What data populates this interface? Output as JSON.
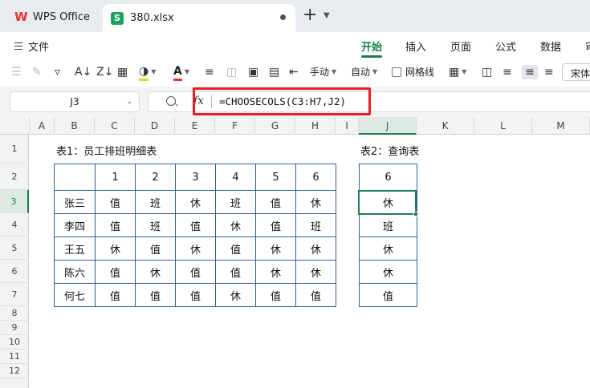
{
  "tabs": {
    "home_label": "WPS Office",
    "file_label": "380.xlsx",
    "new_tab": "+"
  },
  "menu": {
    "file": "文件",
    "ribbon": [
      "开始",
      "插入",
      "页面",
      "公式",
      "数据",
      "审"
    ]
  },
  "toolbar": {
    "wrap_label": "手动",
    "autofit_label": "自动",
    "gridlines_label": "网格线",
    "font_name": "宋体"
  },
  "formula_bar": {
    "cell_ref": "J3",
    "fx": "fx",
    "formula": "=CHOOSECOLS(C3:H7,J2)"
  },
  "columns": [
    "A",
    "B",
    "C",
    "D",
    "E",
    "F",
    "G",
    "H",
    "I",
    "J",
    "K",
    "L",
    "M"
  ],
  "rows": [
    "1",
    "2",
    "3",
    "4",
    "5",
    "6",
    "7",
    "8",
    "9",
    "10",
    "11",
    "12"
  ],
  "sheet": {
    "title1": "表1：员工排班明细表",
    "title2": "表2：查询表",
    "table1": {
      "header": [
        "",
        "1",
        "2",
        "3",
        "4",
        "5",
        "6"
      ],
      "rows": [
        [
          "张三",
          "值",
          "班",
          "休",
          "班",
          "值",
          "休"
        ],
        [
          "李四",
          "值",
          "班",
          "值",
          "休",
          "值",
          "班"
        ],
        [
          "王五",
          "休",
          "值",
          "休",
          "值",
          "休",
          "休"
        ],
        [
          "陈六",
          "值",
          "休",
          "值",
          "值",
          "休",
          "休"
        ],
        [
          "何七",
          "值",
          "值",
          "值",
          "休",
          "值",
          "值"
        ]
      ]
    },
    "table2": {
      "header": "6",
      "values": [
        "休",
        "班",
        "休",
        "休",
        "值"
      ]
    }
  },
  "colors": {
    "accent": "#1a7f4b",
    "table_border": "#2e5fa3",
    "highlight_box": "#ec1c24"
  }
}
